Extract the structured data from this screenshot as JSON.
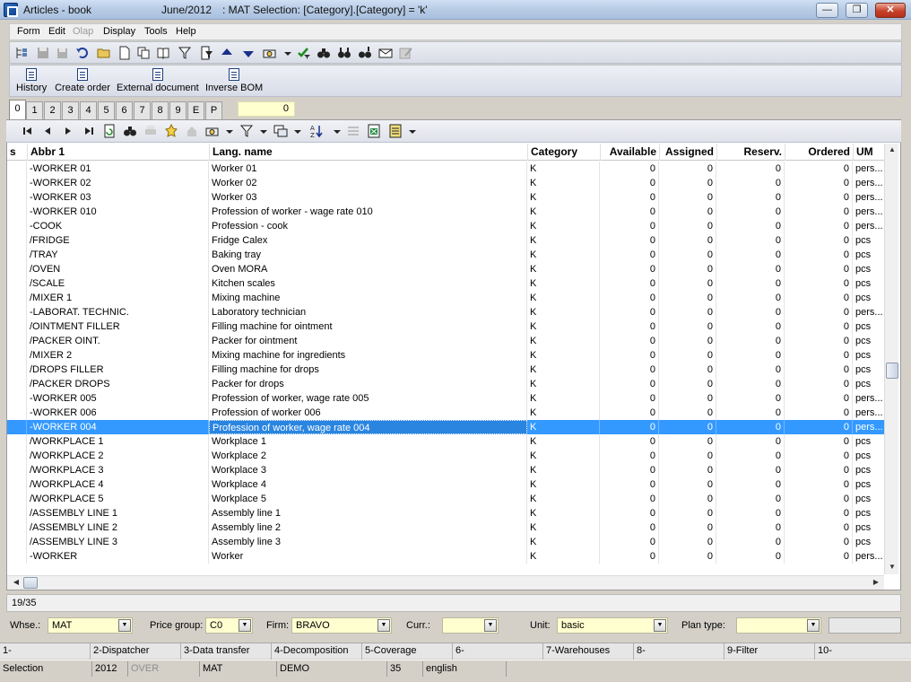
{
  "window": {
    "app_title": "Articles - book",
    "period": "June/2012",
    "selection_info": ": MAT Selection: [Category].[Category] = 'k'",
    "buttons": {
      "minimize": "—",
      "maximize": "❐",
      "close": "✕"
    }
  },
  "menu": {
    "form": "Form",
    "edit": "Edit",
    "olap": "Olap",
    "display": "Display",
    "tools": "Tools",
    "help": "Help"
  },
  "actions": {
    "history": "History",
    "create_order": "Create order",
    "external_document": "External document",
    "inverse_bom": "Inverse BOM"
  },
  "tabs": [
    "0",
    "1",
    "2",
    "3",
    "4",
    "5",
    "6",
    "7",
    "8",
    "9",
    "E",
    "P"
  ],
  "tab_count": "0",
  "grid": {
    "headers": {
      "s": "s",
      "abbr1": "Abbr 1",
      "lang_name": "Lang. name",
      "category": "Category",
      "available": "Available",
      "assigned": "Assigned",
      "reserv": "Reserv.",
      "ordered": "Ordered",
      "um": "UM"
    },
    "rows": [
      {
        "abbr": "-WORKER 01",
        "name": "Worker 01",
        "cat": "K",
        "av": "0",
        "as": "0",
        "re": "0",
        "or": "0",
        "um": "pers..."
      },
      {
        "abbr": "-WORKER 02",
        "name": "Worker 02",
        "cat": "K",
        "av": "0",
        "as": "0",
        "re": "0",
        "or": "0",
        "um": "pers..."
      },
      {
        "abbr": "-WORKER 03",
        "name": "Worker 03",
        "cat": "K",
        "av": "0",
        "as": "0",
        "re": "0",
        "or": "0",
        "um": "pers..."
      },
      {
        "abbr": "-WORKER 010",
        "name": "Profession of worker - wage rate 010",
        "cat": "K",
        "av": "0",
        "as": "0",
        "re": "0",
        "or": "0",
        "um": "pers..."
      },
      {
        "abbr": "-COOK",
        "name": "Profession - cook",
        "cat": "K",
        "av": "0",
        "as": "0",
        "re": "0",
        "or": "0",
        "um": "pers..."
      },
      {
        "abbr": "/FRIDGE",
        "name": "Fridge Calex",
        "cat": "K",
        "av": "0",
        "as": "0",
        "re": "0",
        "or": "0",
        "um": "pcs"
      },
      {
        "abbr": "/TRAY",
        "name": "Baking tray",
        "cat": "K",
        "av": "0",
        "as": "0",
        "re": "0",
        "or": "0",
        "um": "pcs"
      },
      {
        "abbr": "/OVEN",
        "name": "Oven MORA",
        "cat": "K",
        "av": "0",
        "as": "0",
        "re": "0",
        "or": "0",
        "um": "pcs"
      },
      {
        "abbr": "/SCALE",
        "name": "Kitchen scales",
        "cat": "K",
        "av": "0",
        "as": "0",
        "re": "0",
        "or": "0",
        "um": "pcs"
      },
      {
        "abbr": "/MIXER 1",
        "name": "Mixing machine",
        "cat": "K",
        "av": "0",
        "as": "0",
        "re": "0",
        "or": "0",
        "um": "pcs"
      },
      {
        "abbr": "-LABORAT. TECHNIC.",
        "name": "Laboratory technician",
        "cat": "K",
        "av": "0",
        "as": "0",
        "re": "0",
        "or": "0",
        "um": "pers..."
      },
      {
        "abbr": "/OINTMENT FILLER",
        "name": "Filling machine for ointment",
        "cat": "K",
        "av": "0",
        "as": "0",
        "re": "0",
        "or": "0",
        "um": "pcs"
      },
      {
        "abbr": "/PACKER OINT.",
        "name": "Packer for ointment",
        "cat": "K",
        "av": "0",
        "as": "0",
        "re": "0",
        "or": "0",
        "um": "pcs"
      },
      {
        "abbr": "/MIXER 2",
        "name": "Mixing machine for ingredients",
        "cat": "K",
        "av": "0",
        "as": "0",
        "re": "0",
        "or": "0",
        "um": "pcs"
      },
      {
        "abbr": "/DROPS FILLER",
        "name": "Filling machine for drops",
        "cat": "K",
        "av": "0",
        "as": "0",
        "re": "0",
        "or": "0",
        "um": "pcs"
      },
      {
        "abbr": "/PACKER DROPS",
        "name": "Packer for drops",
        "cat": "K",
        "av": "0",
        "as": "0",
        "re": "0",
        "or": "0",
        "um": "pcs"
      },
      {
        "abbr": "-WORKER 005",
        "name": "Profession of worker, wage rate 005",
        "cat": "K",
        "av": "0",
        "as": "0",
        "re": "0",
        "or": "0",
        "um": "pers..."
      },
      {
        "abbr": "-WORKER 006",
        "name": "Profession of worker 006",
        "cat": "K",
        "av": "0",
        "as": "0",
        "re": "0",
        "or": "0",
        "um": "pers..."
      },
      {
        "abbr": "-WORKER 004",
        "name": "Profession of worker, wage rate 004",
        "cat": "K",
        "av": "0",
        "as": "0",
        "re": "0",
        "or": "0",
        "um": "pers...",
        "selected": true
      },
      {
        "abbr": "/WORKPLACE 1",
        "name": "Workplace 1",
        "cat": "K",
        "av": "0",
        "as": "0",
        "re": "0",
        "or": "0",
        "um": "pcs"
      },
      {
        "abbr": "/WORKPLACE 2",
        "name": "Workplace 2",
        "cat": "K",
        "av": "0",
        "as": "0",
        "re": "0",
        "or": "0",
        "um": "pcs"
      },
      {
        "abbr": "/WORKPLACE 3",
        "name": "Workplace 3",
        "cat": "K",
        "av": "0",
        "as": "0",
        "re": "0",
        "or": "0",
        "um": "pcs"
      },
      {
        "abbr": "/WORKPLACE 4",
        "name": "Workplace 4",
        "cat": "K",
        "av": "0",
        "as": "0",
        "re": "0",
        "or": "0",
        "um": "pcs"
      },
      {
        "abbr": "/WORKPLACE 5",
        "name": "Workplace 5",
        "cat": "K",
        "av": "0",
        "as": "0",
        "re": "0",
        "or": "0",
        "um": "pcs"
      },
      {
        "abbr": "/ASSEMBLY LINE 1",
        "name": "Assembly line 1",
        "cat": "K",
        "av": "0",
        "as": "0",
        "re": "0",
        "or": "0",
        "um": "pcs"
      },
      {
        "abbr": "/ASSEMBLY LINE 2",
        "name": "Assembly line 2",
        "cat": "K",
        "av": "0",
        "as": "0",
        "re": "0",
        "or": "0",
        "um": "pcs"
      },
      {
        "abbr": "/ASSEMBLY LINE 3",
        "name": "Assembly line 3",
        "cat": "K",
        "av": "0",
        "as": "0",
        "re": "0",
        "or": "0",
        "um": "pcs"
      },
      {
        "abbr": "-WORKER",
        "name": "Worker",
        "cat": "K",
        "av": "0",
        "as": "0",
        "re": "0",
        "or": "0",
        "um": "pers..."
      }
    ]
  },
  "record_counter": "19/35",
  "filters": {
    "whse_label": "Whse.:",
    "whse_value": "MAT",
    "price_group_label": "Price group:",
    "price_group_value": "C0",
    "firm_label": "Firm:",
    "firm_value": "BRAVO",
    "curr_label": "Curr.:",
    "curr_value": "",
    "unit_label": "Unit:",
    "unit_value": "basic",
    "plan_type_label": "Plan type:",
    "plan_type_value": ""
  },
  "function_keys": [
    "1-",
    "2-Dispatcher",
    "3-Data transfer",
    "4-Decomposition",
    "5-Coverage",
    "6-",
    "7-Warehouses",
    "8-",
    "9-Filter",
    "10-"
  ],
  "status": {
    "mode": "Selection",
    "year": "2012",
    "over": "OVER",
    "module": "MAT",
    "database": "DEMO",
    "number": "35",
    "language": "english"
  },
  "colors": {
    "selection": "#3399ff",
    "field_background": "#ffffd0"
  }
}
